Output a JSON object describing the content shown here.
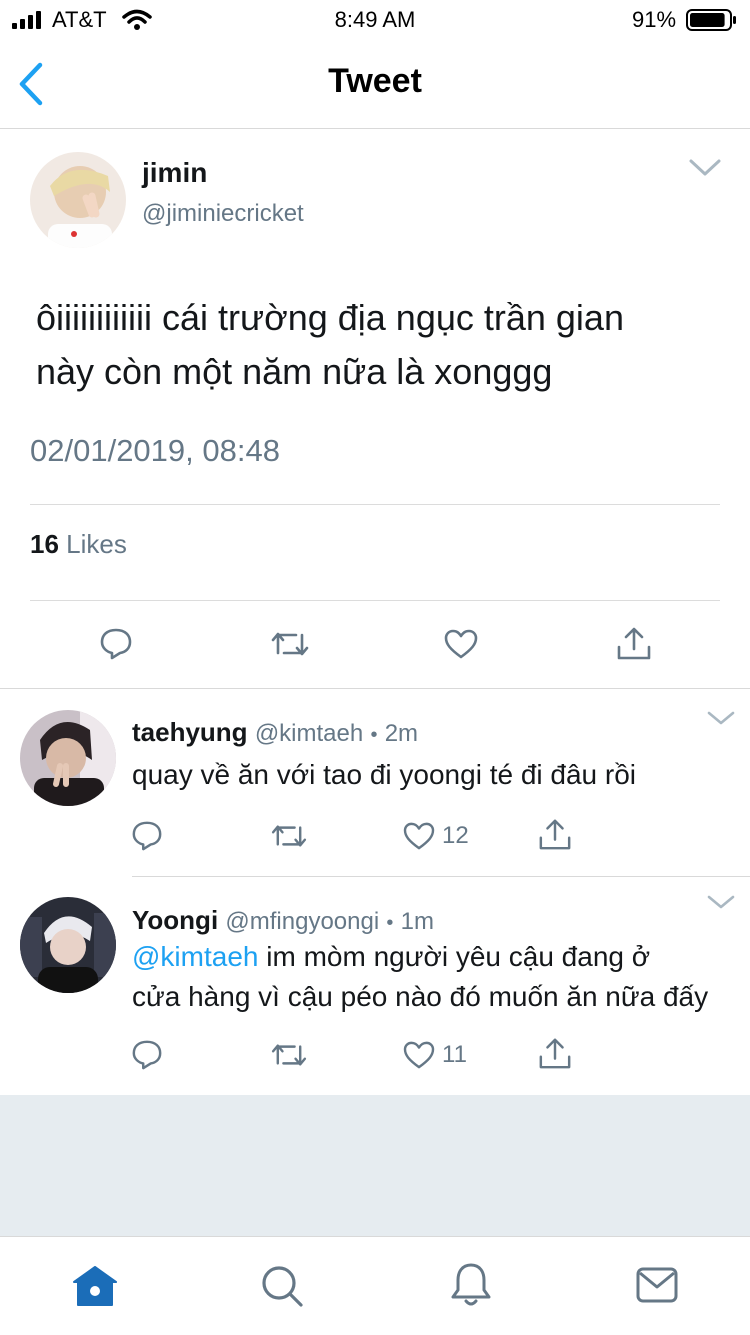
{
  "status_bar": {
    "carrier": "AT&T",
    "time": "8:49 AM",
    "battery": "91%",
    "battery_level": 0.91
  },
  "nav": {
    "title": "Tweet"
  },
  "main_tweet": {
    "name": "jimin",
    "handle": "@jiminiecricket",
    "text_line1": "ôiiiiiiiiiiii cái trường địa ngục trần gian",
    "text_line2": "này còn một năm nữa là xonggg",
    "timestamp": "02/01/2019, 08:48",
    "likes_count": "16",
    "likes_label": "Likes"
  },
  "replies": [
    {
      "name": "taehyung",
      "handle": "@kimtaeh",
      "sep": "•",
      "time": "2m",
      "text": "quay về ăn với tao đi yoongi té đi đâu rồi",
      "like_count": "12"
    },
    {
      "name": "Yoongi",
      "handle": "@mfingyoongi",
      "sep": "•",
      "time": "1m",
      "mention": "@kimtaeh",
      "text_line1": "im mòm người yêu cậu đang ở",
      "text_line2": "cửa hàng vì cậu péo nào đó muốn ăn nữa đấy",
      "like_count": "11"
    }
  ],
  "colors": {
    "accent": "#1da1f2",
    "gray": "#657786",
    "home_active": "#1b6db8"
  },
  "icons": [
    "back-chevron-icon",
    "reply-icon",
    "retweet-icon",
    "like-icon",
    "share-icon",
    "home-icon",
    "search-icon",
    "notifications-icon",
    "messages-icon",
    "chevron-down-icon"
  ]
}
